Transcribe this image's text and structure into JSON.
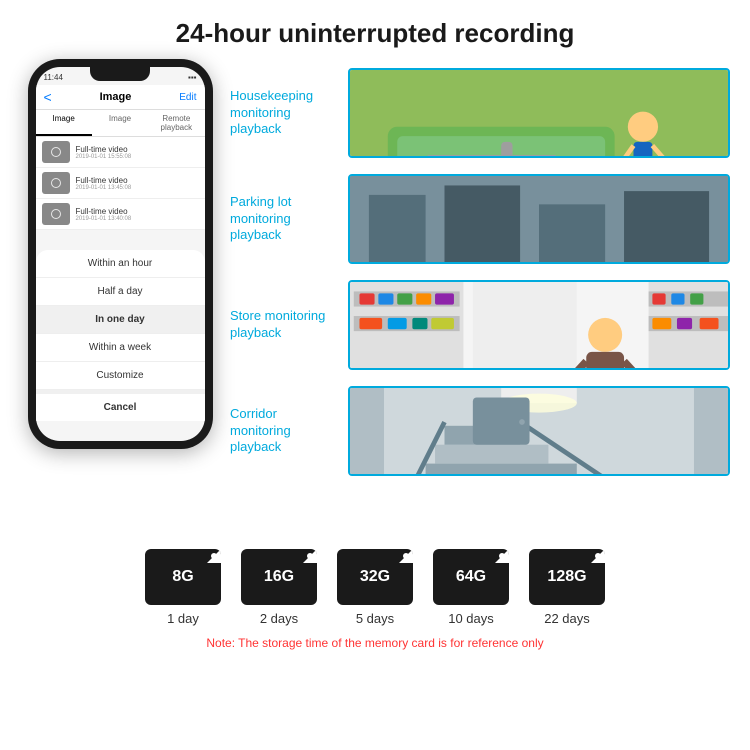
{
  "header": {
    "title": "24-hour uninterrupted recording"
  },
  "phone": {
    "status_time": "11:44",
    "nav": {
      "back": "<",
      "title": "Image",
      "edit": "Edit"
    },
    "tabs": [
      "Image",
      "Image",
      "Remote playback"
    ],
    "list_items": [
      {
        "title": "Full-time video",
        "date": "2019-01-01 15:55:08"
      },
      {
        "title": "Full-time video",
        "date": "2019-01-01 13:45:08"
      },
      {
        "title": "Full-time video",
        "date": "2019-01-01 13:40:08"
      }
    ],
    "dropdown_items": [
      {
        "label": "Within an hour",
        "selected": false
      },
      {
        "label": "Half a day",
        "selected": false
      },
      {
        "label": "In one day",
        "selected": true
      },
      {
        "label": "Within a week",
        "selected": false
      },
      {
        "label": "Customize",
        "selected": false
      }
    ],
    "cancel_label": "Cancel"
  },
  "monitoring": [
    {
      "label": "Housekeeping monitoring playback",
      "scene": "kids-playing"
    },
    {
      "label": "Parking lot monitoring playback",
      "scene": "parking-lot"
    },
    {
      "label": "Store monitoring playback",
      "scene": "store"
    },
    {
      "label": "Corridor monitoring playback",
      "scene": "corridor"
    }
  ],
  "sdcards": [
    {
      "size": "8G",
      "days": "1 day"
    },
    {
      "size": "16G",
      "days": "2 days"
    },
    {
      "size": "32G",
      "days": "5 days"
    },
    {
      "size": "64G",
      "days": "10 days"
    },
    {
      "size": "128G",
      "days": "22 days"
    }
  ],
  "note": "Note: The storage time of the memory card is for reference only",
  "colors": {
    "accent": "#00aadd",
    "title": "#1a1a1a",
    "note": "#ff3333"
  }
}
